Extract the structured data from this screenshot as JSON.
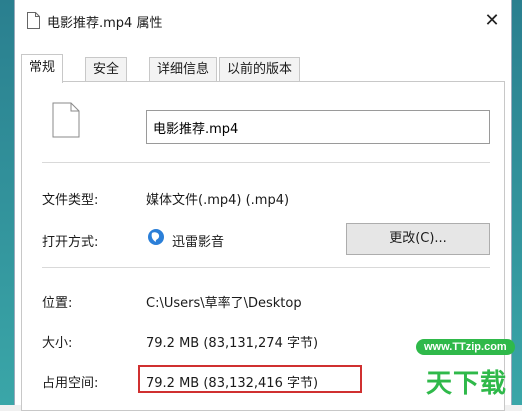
{
  "window": {
    "title": "电影推荐.mp4 属性",
    "close_glyph": "✕"
  },
  "tabs": [
    {
      "label": "常规",
      "active": true
    },
    {
      "label": "安全",
      "active": false
    },
    {
      "label": "详细信息",
      "active": false
    },
    {
      "label": "以前的版本",
      "active": false
    }
  ],
  "general": {
    "file_name": "电影推荐.mp4",
    "rows": [
      {
        "label": "文件类型:",
        "value": "媒体文件(.mp4) (.mp4)"
      },
      {
        "label": "打开方式:",
        "value": "迅雷影音"
      },
      {
        "label": "位置:",
        "value": "C:\\Users\\草率了\\Desktop"
      },
      {
        "label": "大小:",
        "value": "79.2 MB (83,131,274 字节)"
      },
      {
        "label": "占用空间:",
        "value": "79.2 MB (83,132,416 字节)"
      }
    ],
    "change_button": "更改(C)..."
  },
  "watermark": {
    "url": "www.TTzip.com",
    "text": "天下载"
  },
  "colors": {
    "highlight": "#d03030",
    "watermark": "#2fb94a",
    "desktop": "#2f8fa3"
  }
}
